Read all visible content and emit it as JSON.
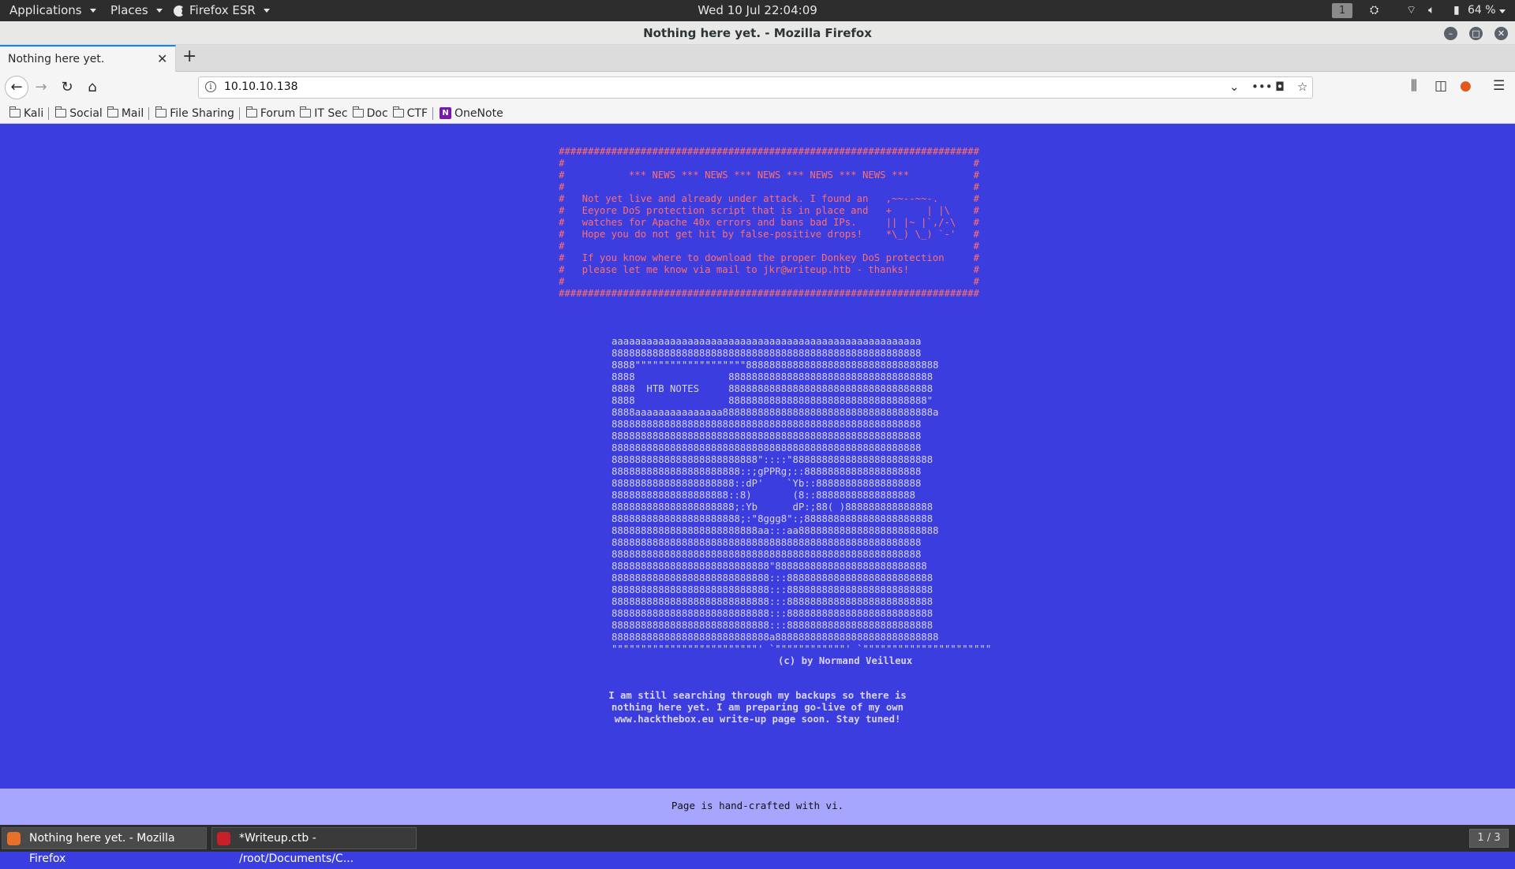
{
  "topbar": {
    "applications": "Applications",
    "places": "Places",
    "firefox": "Firefox ESR",
    "clock": "Wed 10 Jul  22:04:09",
    "workspace": "1",
    "battery": "64 %"
  },
  "window": {
    "title": "Nothing here yet. - Mozilla Firefox"
  },
  "tab": {
    "title": "Nothing here yet."
  },
  "urlbar": {
    "url": "10.10.10.138"
  },
  "bookmarks": [
    "Kali",
    "Social",
    "Mail",
    "File Sharing",
    "Forum",
    "IT Sec",
    "Doc",
    "CTF",
    "OneNote"
  ],
  "page": {
    "news_block": "########################################################################\n#                                                                      #\n#           *** NEWS *** NEWS *** NEWS *** NEWS *** NEWS ***           #\n#                                                                      #\n#   Not yet live and already under attack. I found an   ,~~--~~-.      #\n#   Eeyore DoS protection script that is in place and   +      | |\\    #\n#   watches for Apache 40x errors and bans bad IPs.     || |~ |`,/-\\   #\n#   Hope you do not get hit by false-positive drops!    *\\_) \\_) `-'   #\n#                                                                      #\n#   If you know where to download the proper Donkey DoS protection     #\n#   please let me know via mail to jkr@writeup.htb - thanks!           #\n#                                                                      #\n########################################################################",
    "ascii_art": "aaaaaaaaaaaaaaaaaaaaaaaaaaaaaaaaaaaaaaaaaaaaaaaaaaaaa\n88888888888888888888888888888888888888888888888888888\n8888\"\"\"\"\"\"\"\"\"\"\"\"\"\"\"\"\"\"\"888888888888888888888888888888888\n8888                88888888888888888888888888888888888\n8888  HTB NOTES     88888888888888888888888888888888888\n8888                8888888888888888888888888888888888\"\n8888aaaaaaaaaaaaaaa888888888888888888888888888888888888a\n88888888888888888888888888888888888888888888888888888\n88888888888888888888888888888888888888888888888888888\n88888888888888888888888888888888888888888888888888888\n8888888888888888888888888\"::::\"888888888888888888888888\n8888888888888888888888::;gPPRg;::88888888888888888888\n888888888888888888888::dP'    `Yb::888888888888888888\n88888888888888888888::8)       (8::88888888888888888\n888888888888888888888;:Yb      dP:;88( )888888888888888\n8888888888888888888888;:\"8ggg8\":;8888888888888888888888\n8888888888888888888888888aa:::aa888888888888888888888888\n88888888888888888888888888888888888888888888888888888\n88888888888888888888888888888888888888888888888888888\n888888888888888888888888888\"88888888888888888888888888\n888888888888888888888888888:::8888888888888888888888888\n888888888888888888888888888:::8888888888888888888888888\n888888888888888888888888888:::8888888888888888888888888\n888888888888888888888888888:::8888888888888888888888888\n888888888888888888888888888:::8888888888888888888888888\n888888888888888888888888888a8888888888888888888888888888\n\"\"\"\"\"\"\"\"\"\"\"\"\"\"\"\"\"\"\"\"\"\"\"\"\"' `\"\"\"\"\"\"\"\"\"\"\"\"' `\"\"\"\"\"\"\"\"\"\"\"\"\"\"\"\"\"\"\"\"\"\"",
    "credit": "(c) by Normand Veilleux",
    "message": "I am still searching through my backups so there is\nnothing here yet. I am preparing go-live of my own\nwww.hackthebox.eu write-up page soon. Stay tuned!",
    "footer": "Page is hand-crafted with vi."
  },
  "taskbar": {
    "firefox_task": "Nothing here yet. - Mozilla Firefox",
    "cherrytree_task": "*Writeup.ctb - /root/Documents/C...",
    "pager": "1 / 3"
  }
}
